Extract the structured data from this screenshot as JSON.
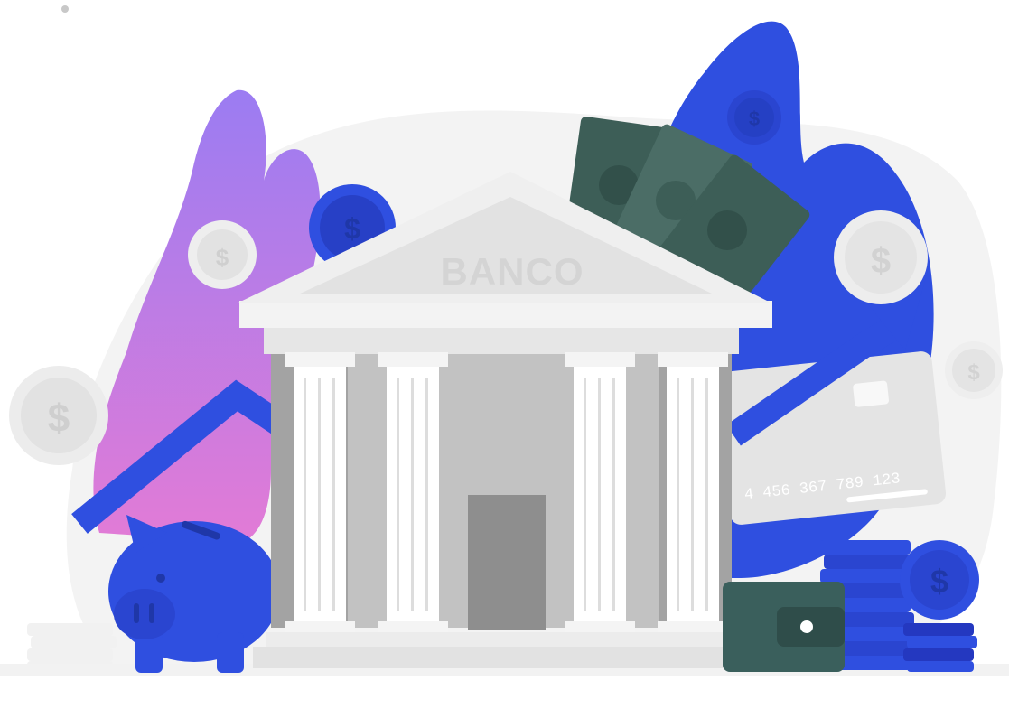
{
  "illustration": {
    "bank_sign": "BANCO",
    "card_number": "4 456 367 789 123",
    "coin_symbol": "$",
    "icons": [
      "bank-building-icon",
      "piggy-bank-icon",
      "wallet-icon",
      "credit-card-icon",
      "banknote-icon",
      "coin-icon",
      "coin-stack-icon",
      "growth-arrow-icon",
      "leaf-icon"
    ],
    "colors": {
      "blue": "#2f4fe0",
      "dark_blue": "#2438c0",
      "purple": "#a77bf0",
      "pink": "#e07ad8",
      "building_light": "#ececec",
      "building_mid": "#d0d0d0",
      "building_dark": "#9a9a9a",
      "money_green": "#3d5e57",
      "wallet": "#3a5f5c",
      "coin_light": "#eeeeee",
      "ground": "#f3f3f3"
    }
  }
}
